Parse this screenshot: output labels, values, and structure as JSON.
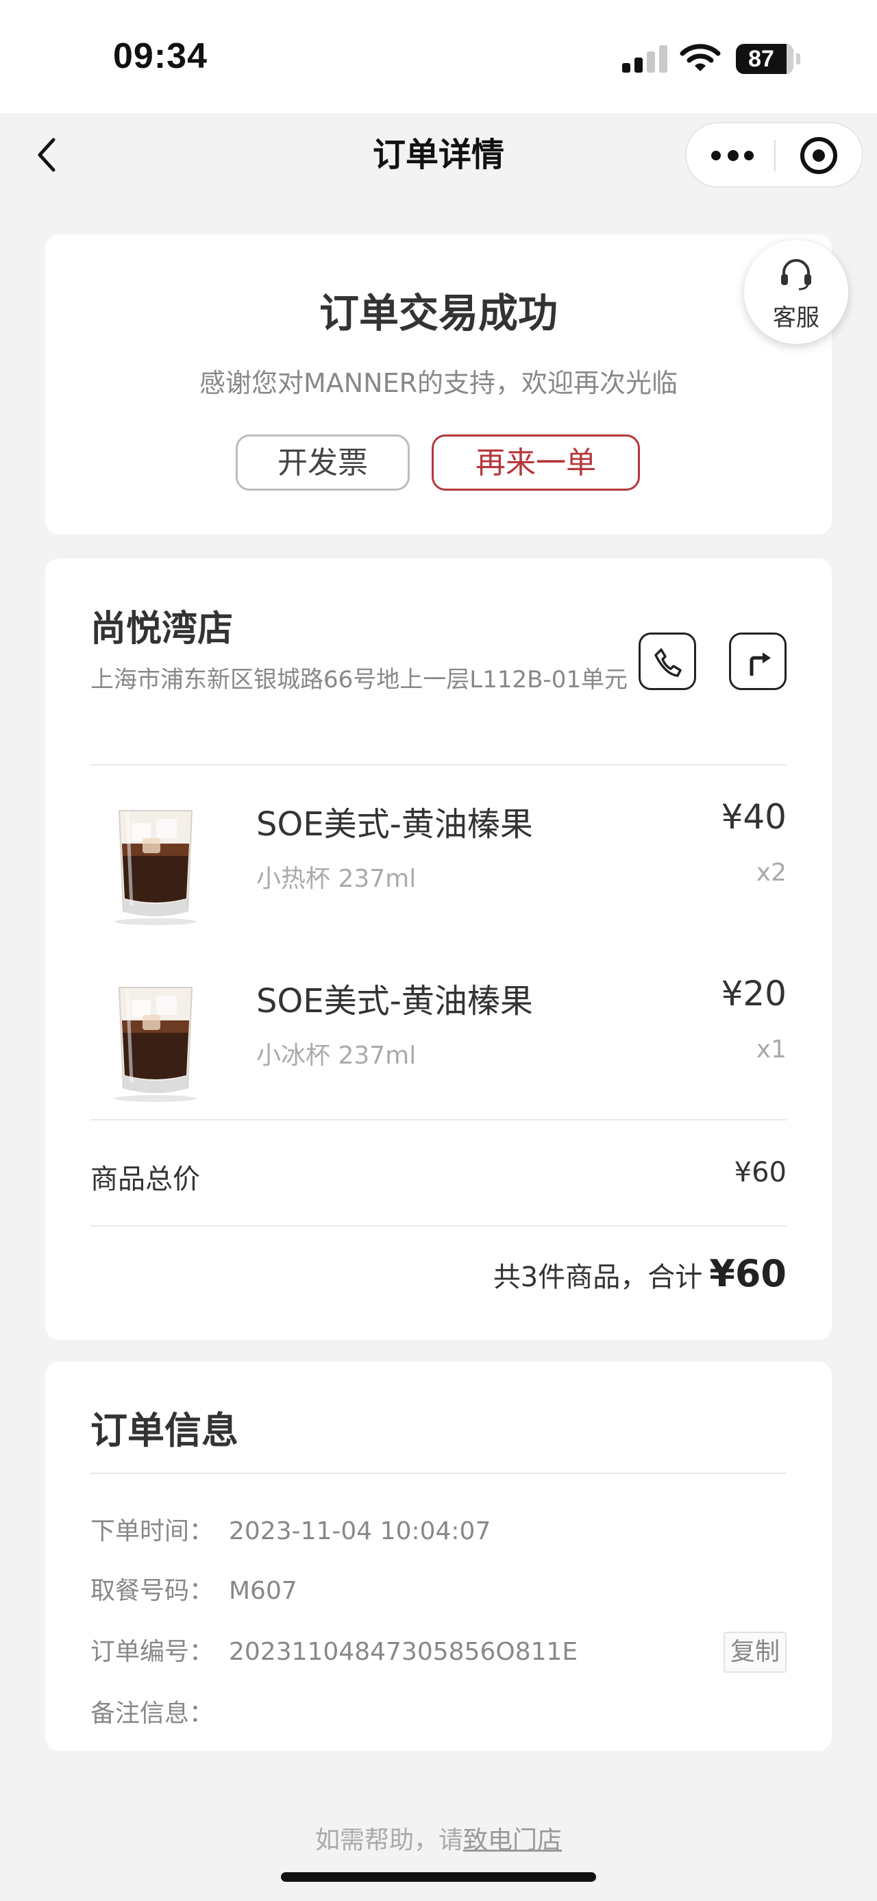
{
  "status_bar": {
    "time": "09:34",
    "battery": "87"
  },
  "nav": {
    "title": "订单详情"
  },
  "order_status": {
    "title": "订单交易成功",
    "subtitle": "感谢您对MANNER的支持，欢迎再次光临",
    "invoice_label": "开发票",
    "reorder_label": "再来一单"
  },
  "service": {
    "label": "客服"
  },
  "store": {
    "name": "尚悦湾店",
    "address": "上海市浦东新区银城路66号地上一层L112B-01单元"
  },
  "products": [
    {
      "name": "SOE美式-黄油榛果",
      "spec": "小热杯 237ml",
      "price": "¥40",
      "qty": "x2"
    },
    {
      "name": "SOE美式-黄油榛果",
      "spec": "小冰杯 237ml",
      "price": "¥20",
      "qty": "x1"
    }
  ],
  "summary": {
    "subtotal_label": "商品总价",
    "subtotal_value": "¥60",
    "total_prefix": "共3件商品，合计",
    "total_amount": "¥60"
  },
  "order_info": {
    "title": "订单信息",
    "rows": [
      {
        "label": "下单时间：",
        "value": "2023-11-04 10:04:07"
      },
      {
        "label": "取餐号码：",
        "value": "M607"
      },
      {
        "label": "订单编号：",
        "value": "20231104847305856O811E"
      },
      {
        "label": "备注信息：",
        "value": ""
      }
    ],
    "copy_label": "复制"
  },
  "footer": {
    "help_prefix": "如需帮助，请",
    "help_link": "致电门店"
  },
  "colors": {
    "accent": "#b5373b",
    "page_bg": "#f3f3f3",
    "card_bg": "#ffffff"
  }
}
